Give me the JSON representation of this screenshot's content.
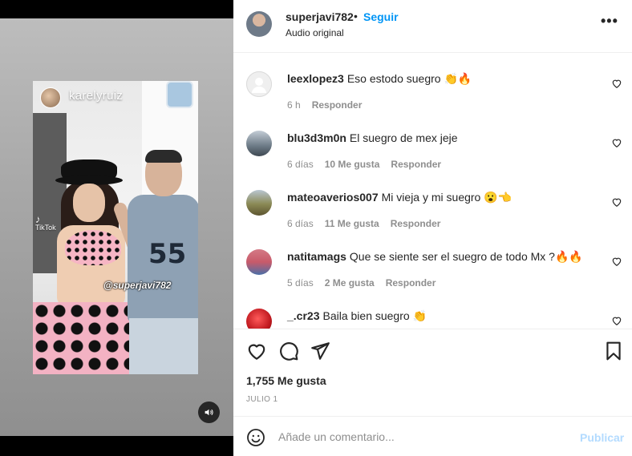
{
  "media": {
    "tiktok_username": "karelyruiz",
    "tiktok_logo_text": "TikTok",
    "watermark": "@superjavi782",
    "jersey_number": "55"
  },
  "header": {
    "username": "superjavi782",
    "separator": "•",
    "follow_label": "Seguir",
    "audio_label": "Audio original",
    "more_label": "•••"
  },
  "comments": [
    {
      "user": "leexlopez3",
      "text": "Eso estodo suegro 👏🔥",
      "time": "6 h",
      "likes": "",
      "reply": "Responder",
      "avatar_color": "#e0e0e0"
    },
    {
      "user": "blu3d3m0n",
      "text": "El suegro de mex jeje",
      "time": "6 días",
      "likes": "10 Me gusta",
      "reply": "Responder",
      "avatar_color": "#6c7a86"
    },
    {
      "user": "mateoaverios007",
      "text": "Mi vieja y mi suegro 😮👈",
      "time": "6 días",
      "likes": "11 Me gusta",
      "reply": "Responder",
      "avatar_color": "#8b8a55"
    },
    {
      "user": "natitamags",
      "text": "Que se siente ser el suegro de todo Mx ?🔥🔥",
      "time": "5 días",
      "likes": "2 Me gusta",
      "reply": "Responder",
      "avatar_color": "#c85a6a"
    },
    {
      "user": "_.cr23",
      "text": "Baila bien suegro 👏",
      "time": "",
      "likes": "",
      "reply": "",
      "avatar_color": "#c0191f"
    }
  ],
  "post": {
    "likes": "1,755 Me gusta",
    "date": "JULIO 1",
    "comment_placeholder": "Añade un comentario...",
    "publish_label": "Publicar"
  },
  "colors": {
    "accent": "#0095f6",
    "publish_disabled": "#b3dbff",
    "muted": "#8e8e8e"
  }
}
